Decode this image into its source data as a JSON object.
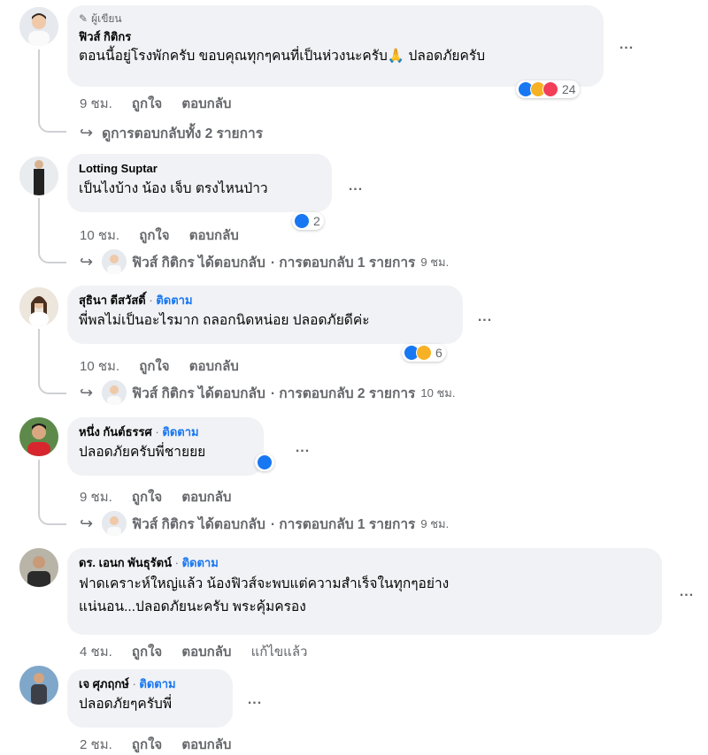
{
  "comments": [
    {
      "author_badge": "ผู้เขียน",
      "author": "ฟิวส์ กิติกร",
      "text": "ตอนนี้อยู่โรงพักครับ ขอบคุณทุกๆคนที่เป็นห่วงนะครับ🙏 ปลอดภัยครับ",
      "reaction_count": "24",
      "time": "9 ชม.",
      "like": "ถูกใจ",
      "reply": "ตอบกลับ",
      "replies_summary": "ดูการตอบกลับทั้ง 2 รายการ"
    },
    {
      "author": "Lotting Suptar",
      "text": "เป็นไงบ้าง น้อง เจ็บ ตรงไหนป่าว",
      "reaction_count": "2",
      "time": "10 ชม.",
      "like": "ถูกใจ",
      "reply": "ตอบกลับ",
      "replied_by": "ฟิวส์ กิติกร ได้ตอบกลับ",
      "reply_count": "· การตอบกลับ 1 รายการ",
      "reply_time": "9 ชม."
    },
    {
      "author": "สุธินา ดีสวัสดิ์",
      "follow": "ติดตาม",
      "text": "พี่พลไม่เป็นอะไรมาก ถลอกนิดหน่อย ปลอดภัยดีค่ะ",
      "reaction_count": "6",
      "time": "10 ชม.",
      "like": "ถูกใจ",
      "reply": "ตอบกลับ",
      "replied_by": "ฟิวส์ กิติกร ได้ตอบกลับ",
      "reply_count": "· การตอบกลับ 2 รายการ",
      "reply_time": "10 ชม."
    },
    {
      "author": "หนึ่ง กันต์ธรรศ",
      "follow": "ติดตาม",
      "text": "ปลอดภัยครับพี่ชายยย",
      "time": "9 ชม.",
      "like": "ถูกใจ",
      "reply": "ตอบกลับ",
      "replied_by": "ฟิวส์ กิติกร ได้ตอบกลับ",
      "reply_count": "· การตอบกลับ 1 รายการ",
      "reply_time": "9 ชม."
    },
    {
      "author": "ดร. เอนก พันธุรัตน์",
      "follow": "ติดตาม",
      "text_line1": "ฟาดเคราะห์ใหญ่แล้ว น้องฟิวส์จะพบแต่ความสำเร็จในทุกๆอย่าง",
      "text_line2": "แน่นอน...ปลอดภัยนะครับ พระคุ้มครอง",
      "time": "4 ชม.",
      "like": "ถูกใจ",
      "reply": "ตอบกลับ",
      "edited": "แก้ไขแล้ว"
    },
    {
      "author": "เจ ศุภฤกษ์",
      "follow": "ติดตาม",
      "text": "ปลอดภัยๆครับพี่",
      "time": "2 ชม.",
      "like": "ถูกใจ",
      "reply": "ตอบกลับ"
    }
  ],
  "dot": "·",
  "more_icon": "...",
  "reply_arrow": "↪",
  "colors": {
    "link": "#1877f2",
    "bubble": "#f0f2f5",
    "muted": "#65676b"
  }
}
